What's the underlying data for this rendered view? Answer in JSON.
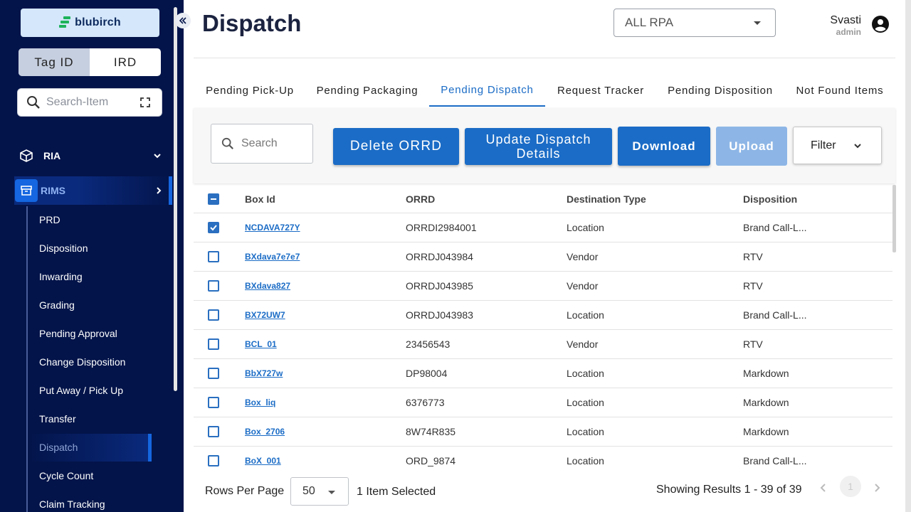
{
  "sidebar": {
    "logo_text": "blubirch",
    "toggle": {
      "left": "Tag ID",
      "right": "IRD",
      "active": "Tag ID"
    },
    "search_placeholder": "Search-Item",
    "sections": [
      {
        "label": "RIA",
        "icon": "box-icon",
        "expanded": false
      },
      {
        "label": "RIMS",
        "icon": "archive-icon",
        "expanded": true
      }
    ],
    "items": [
      "PRD",
      "Disposition",
      "Inwarding",
      "Grading",
      "Pending Approval",
      "Change Disposition",
      "Put Away / Pick Up",
      "Transfer",
      "Dispatch",
      "Cycle Count",
      "Claim Tracking"
    ],
    "active_item": "Dispatch"
  },
  "header": {
    "title": "Dispatch",
    "rpa_select": "ALL RPA",
    "user_name": "Svasti",
    "user_role": "admin"
  },
  "tabs": [
    "Pending Pick-Up",
    "Pending Packaging",
    "Pending Dispatch",
    "Request Tracker",
    "Pending Disposition",
    "Not Found Items"
  ],
  "active_tab": "Pending Dispatch",
  "toolbar": {
    "search_placeholder": "Search",
    "delete_label": "Delete ORRD",
    "update_label_1": "Update Dispatch",
    "update_label_2": "Details",
    "download_label": "Download",
    "upload_label": "Upload",
    "filter_label": "Filter"
  },
  "table": {
    "columns": [
      "Box Id",
      "ORRD",
      "Destination Type",
      "Disposition"
    ],
    "rows": [
      {
        "checked": true,
        "box_id": "NCDAVA727Y",
        "orrd": "ORRDI2984001",
        "dest": "Location",
        "disp": "Brand Call-L..."
      },
      {
        "checked": false,
        "box_id": "BXdava7e7e7",
        "orrd": "ORRDJ043984",
        "dest": "Vendor",
        "disp": "RTV"
      },
      {
        "checked": false,
        "box_id": "BXdava827",
        "orrd": "ORRDJ043985",
        "dest": "Vendor",
        "disp": "RTV"
      },
      {
        "checked": false,
        "box_id": "BX72UW7",
        "orrd": "ORRDJ043983",
        "dest": "Location",
        "disp": "Brand Call-L..."
      },
      {
        "checked": false,
        "box_id": "BCL_01",
        "orrd": "23456543",
        "dest": "Vendor",
        "disp": "RTV"
      },
      {
        "checked": false,
        "box_id": "BbX727w",
        "orrd": "DP98004",
        "dest": "Location",
        "disp": "Markdown"
      },
      {
        "checked": false,
        "box_id": "Box_liq",
        "orrd": "6376773",
        "dest": "Location",
        "disp": "Markdown"
      },
      {
        "checked": false,
        "box_id": "Box_2706",
        "orrd": "8W74R835",
        "dest": "Location",
        "disp": "Markdown"
      },
      {
        "checked": false,
        "box_id": "BoX_001",
        "orrd": "ORD_9874",
        "dest": "Location",
        "disp": "Brand Call-L..."
      }
    ]
  },
  "footer": {
    "rows_per_page_label": "Rows Per Page",
    "rows_per_page": "50",
    "selected_text": "1 Item Selected",
    "results_text": "Showing Results 1 - 39 of 39",
    "page": "1"
  },
  "colors": {
    "sidebar_bg": "#03144a",
    "primary": "#1b6cc6",
    "accent": "#1566e0",
    "logo_green": "#1db35a"
  }
}
